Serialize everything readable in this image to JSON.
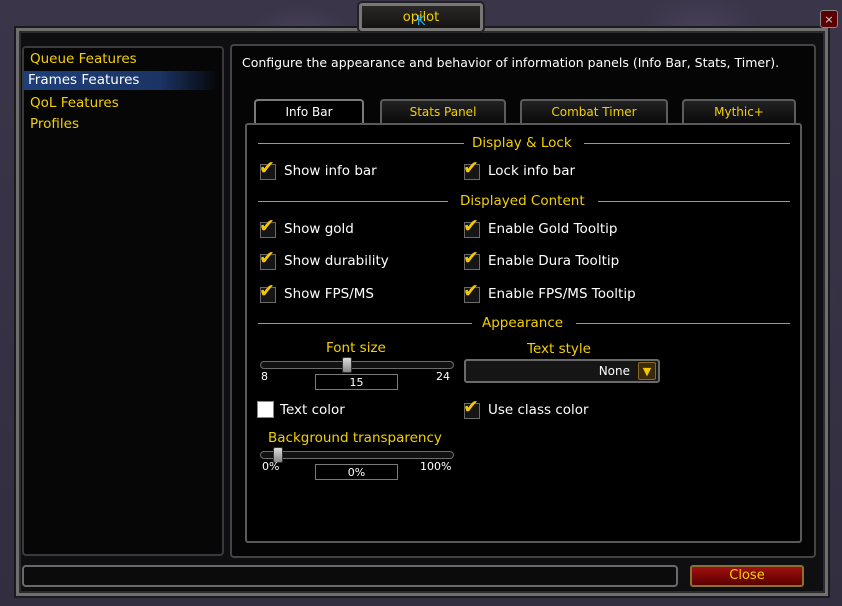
{
  "window": {
    "title_prefix": "K",
    "title_rest": "opilot",
    "close_x": "×"
  },
  "sidebar": {
    "items": [
      {
        "label": "Queue Features"
      },
      {
        "label": "Frames Features"
      },
      {
        "label": "QoL Features"
      },
      {
        "label": "Profiles"
      }
    ]
  },
  "main": {
    "description": "Configure the appearance and behavior of information panels (Info Bar, Stats, Timer).",
    "tabs": [
      {
        "label": "Info Bar"
      },
      {
        "label": "Stats Panel"
      },
      {
        "label": "Combat Timer"
      },
      {
        "label": "Mythic+"
      }
    ]
  },
  "sections": {
    "display_lock": "Display & Lock",
    "displayed_content": "Displayed Content",
    "appearance": "Appearance"
  },
  "options": {
    "show_info_bar": {
      "label": "Show info bar",
      "checked": true
    },
    "lock_info_bar": {
      "label": "Lock info bar",
      "checked": true
    },
    "show_gold": {
      "label": "Show gold",
      "checked": true
    },
    "enable_gold_tooltip": {
      "label": "Enable Gold Tooltip",
      "checked": true
    },
    "show_durability": {
      "label": "Show durability",
      "checked": true
    },
    "enable_dura_tooltip": {
      "label": "Enable Dura Tooltip",
      "checked": true
    },
    "show_fps_ms": {
      "label": "Show FPS/MS",
      "checked": true
    },
    "enable_fps_tooltip": {
      "label": "Enable FPS/MS Tooltip",
      "checked": true
    },
    "use_class_color": {
      "label": "Use class color",
      "checked": true
    },
    "text_color": {
      "label": "Text color",
      "color": "#ffffff"
    }
  },
  "font_size": {
    "label": "Font size",
    "min": "8",
    "max": "24",
    "value": "15"
  },
  "text_style": {
    "label": "Text style",
    "value": "None"
  },
  "bg_transparency": {
    "label": "Background transparency",
    "min": "0%",
    "max": "100%",
    "value": "0%"
  },
  "footer": {
    "close_label": "Close"
  },
  "icons": {
    "check": "✔",
    "dropdown_arrow": "▼"
  },
  "colors": {
    "accent_gold": "#f3d000",
    "selected_nav": "#1f3f7a",
    "close_button": "#a01010"
  }
}
